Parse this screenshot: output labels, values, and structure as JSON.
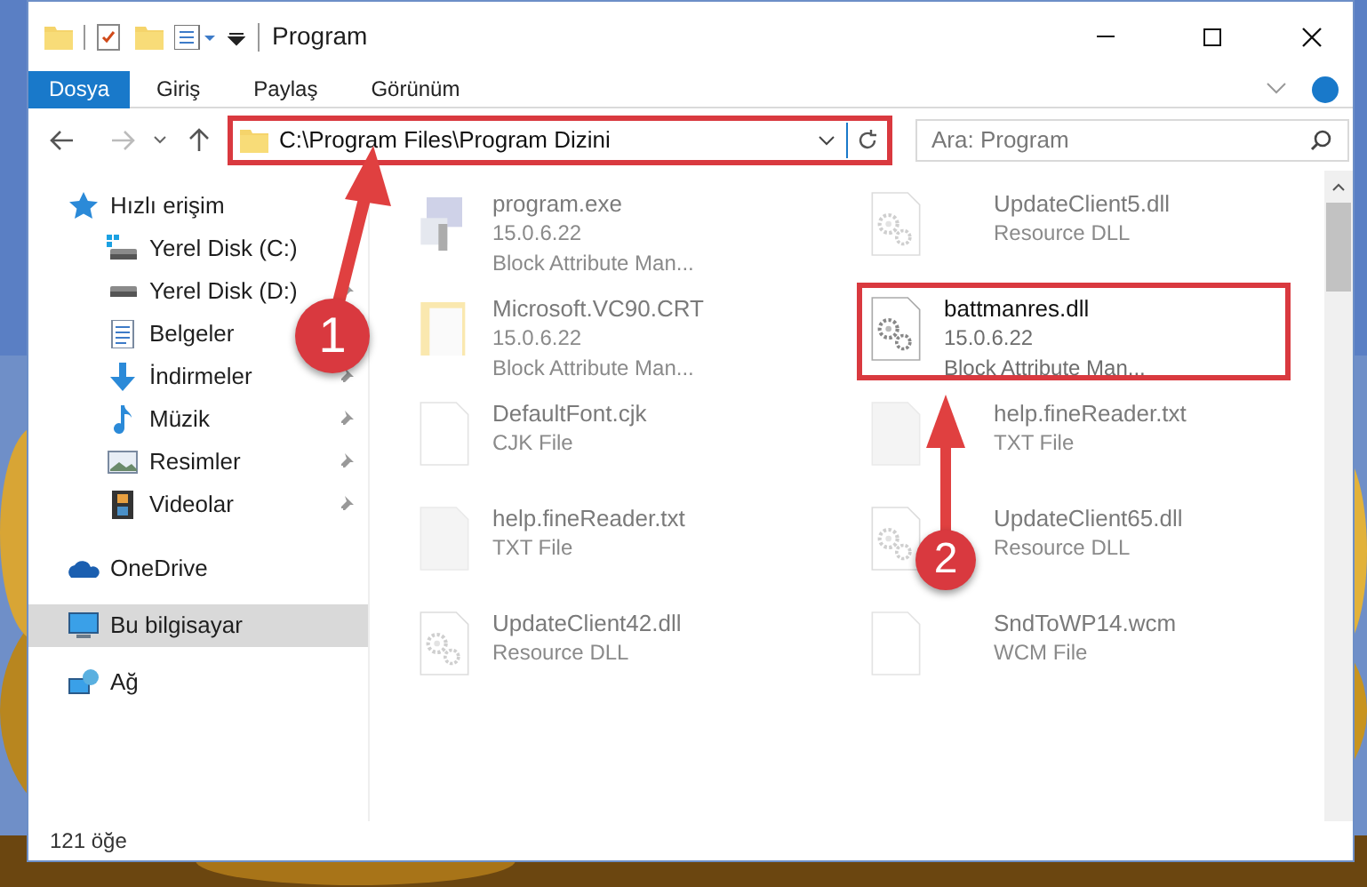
{
  "window": {
    "title": "Program"
  },
  "ribbon_tabs": [
    {
      "label": "Dosya",
      "kind": "file"
    },
    {
      "label": "Giriş",
      "kind": "tab"
    },
    {
      "label": "Paylaş",
      "kind": "tab"
    },
    {
      "label": "Görünüm",
      "kind": "tab"
    }
  ],
  "address_bar": {
    "value": "C:\\Program Files\\Program Dizini",
    "highlighted": true
  },
  "search": {
    "placeholder": "Ara: Program"
  },
  "sidebar": {
    "items": [
      {
        "label": "Hızlı erişim",
        "kind": "star",
        "selected": false,
        "children": [
          {
            "label": "Yerel Disk (C:)",
            "kind": "drive-win",
            "pinned": false,
            "selected": false
          },
          {
            "label": "Yerel Disk (D:)",
            "kind": "drive",
            "pinned": true,
            "selected": false
          },
          {
            "label": "Belgeler",
            "kind": "docs",
            "pinned": false,
            "selected": false
          },
          {
            "label": "İndirmeler",
            "kind": "download",
            "pinned": true,
            "selected": false
          },
          {
            "label": "Müzik",
            "kind": "music",
            "pinned": true,
            "selected": false
          },
          {
            "label": "Resimler",
            "kind": "pictures",
            "pinned": true,
            "selected": false
          },
          {
            "label": "Videolar",
            "kind": "videos",
            "pinned": true,
            "selected": false
          }
        ]
      },
      {
        "label": "OneDrive",
        "kind": "cloud",
        "selected": false
      },
      {
        "label": "Bu bilgisayar",
        "kind": "pc",
        "selected": true
      },
      {
        "label": "Ağ",
        "kind": "network",
        "selected": false
      }
    ]
  },
  "files": [
    {
      "name": "program.exe",
      "lines": [
        "15.0.6.22",
        "Block Attribute Man..."
      ],
      "kind": "exe",
      "dimmed": true,
      "highlighted": false
    },
    {
      "name": "UpdateClient5.dll",
      "lines": [
        "Resource DLL"
      ],
      "kind": "dll",
      "dimmed": true,
      "highlighted": false
    },
    {
      "name": "Microsoft.VC90.CRT",
      "lines": [
        "15.0.6.22",
        "Block Attribute Man..."
      ],
      "kind": "folder",
      "dimmed": true,
      "highlighted": false
    },
    {
      "name": "battmanres.dll",
      "lines": [
        "15.0.6.22",
        "Block Attribute Man..."
      ],
      "kind": "dll",
      "dimmed": false,
      "highlighted": true
    },
    {
      "name": "DefaultFont.cjk",
      "lines": [
        "CJK File"
      ],
      "kind": "file",
      "dimmed": true,
      "highlighted": false
    },
    {
      "name": "help.fineReader.txt",
      "lines": [
        "TXT File"
      ],
      "kind": "text",
      "dimmed": true,
      "highlighted": false
    },
    {
      "name": "help.fineReader.txt",
      "lines": [
        "TXT File"
      ],
      "kind": "text",
      "dimmed": true,
      "highlighted": false
    },
    {
      "name": "UpdateClient65.dll",
      "lines": [
        "Resource DLL"
      ],
      "kind": "dll",
      "dimmed": true,
      "highlighted": false
    },
    {
      "name": "UpdateClient42.dll",
      "lines": [
        "Resource DLL"
      ],
      "kind": "dll",
      "dimmed": true,
      "highlighted": false
    },
    {
      "name": "SndToWP14.wcm",
      "lines": [
        "WCM File"
      ],
      "kind": "file",
      "dimmed": true,
      "highlighted": false
    }
  ],
  "status_bar": {
    "count": "121 öğe"
  },
  "annotations": [
    {
      "label": "1"
    },
    {
      "label": "2"
    }
  ]
}
